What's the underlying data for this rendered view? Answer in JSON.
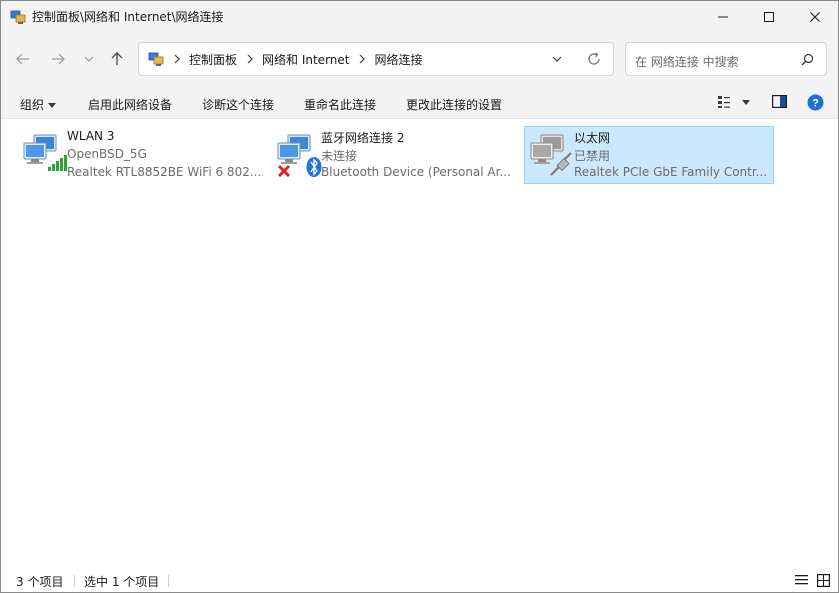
{
  "window": {
    "title": "控制面板\\网络和 Internet\\网络连接",
    "title_icon": "network-connections-icon"
  },
  "navigation": {
    "back_icon": "arrow-left-icon",
    "forward_icon": "arrow-right-icon",
    "recent_icon": "chevron-down-icon",
    "up_icon": "arrow-up-icon"
  },
  "address": {
    "crumbs": [
      "控制面板",
      "网络和 Internet",
      "网络连接"
    ],
    "dropdown_icon": "chevron-down-icon",
    "refresh_icon": "refresh-icon"
  },
  "search": {
    "placeholder": "在 网络连接 中搜索",
    "icon": "search-icon"
  },
  "commands": {
    "organize": "组织",
    "enable": "启用此网络设备",
    "diagnose": "诊断这个连接",
    "rename": "重命名此连接",
    "change_settings": "更改此连接的设置"
  },
  "connections": [
    {
      "name": "WLAN 3",
      "status": "OpenBSD_5G",
      "device": "Realtek RTL8852BE WiFi 6 802....",
      "icon": "wifi-network-icon",
      "selected": false
    },
    {
      "name": "蓝牙网络连接 2",
      "status": "未连接",
      "device": "Bluetooth Device (Personal Ar...",
      "icon": "bluetooth-network-icon",
      "selected": false
    },
    {
      "name": "以太网",
      "status": "已禁用",
      "device": "Realtek PCIe GbE Family Contr...",
      "icon": "ethernet-network-icon",
      "selected": true
    }
  ],
  "status": {
    "item_count": "3 个项目",
    "selected_count": "选中 1 个项目"
  },
  "colors": {
    "chrome_bg": "#f3f3f3",
    "selection_bg": "#cce8ff",
    "selection_border": "#99d1ff",
    "help_blue": "#1e6fd9"
  }
}
